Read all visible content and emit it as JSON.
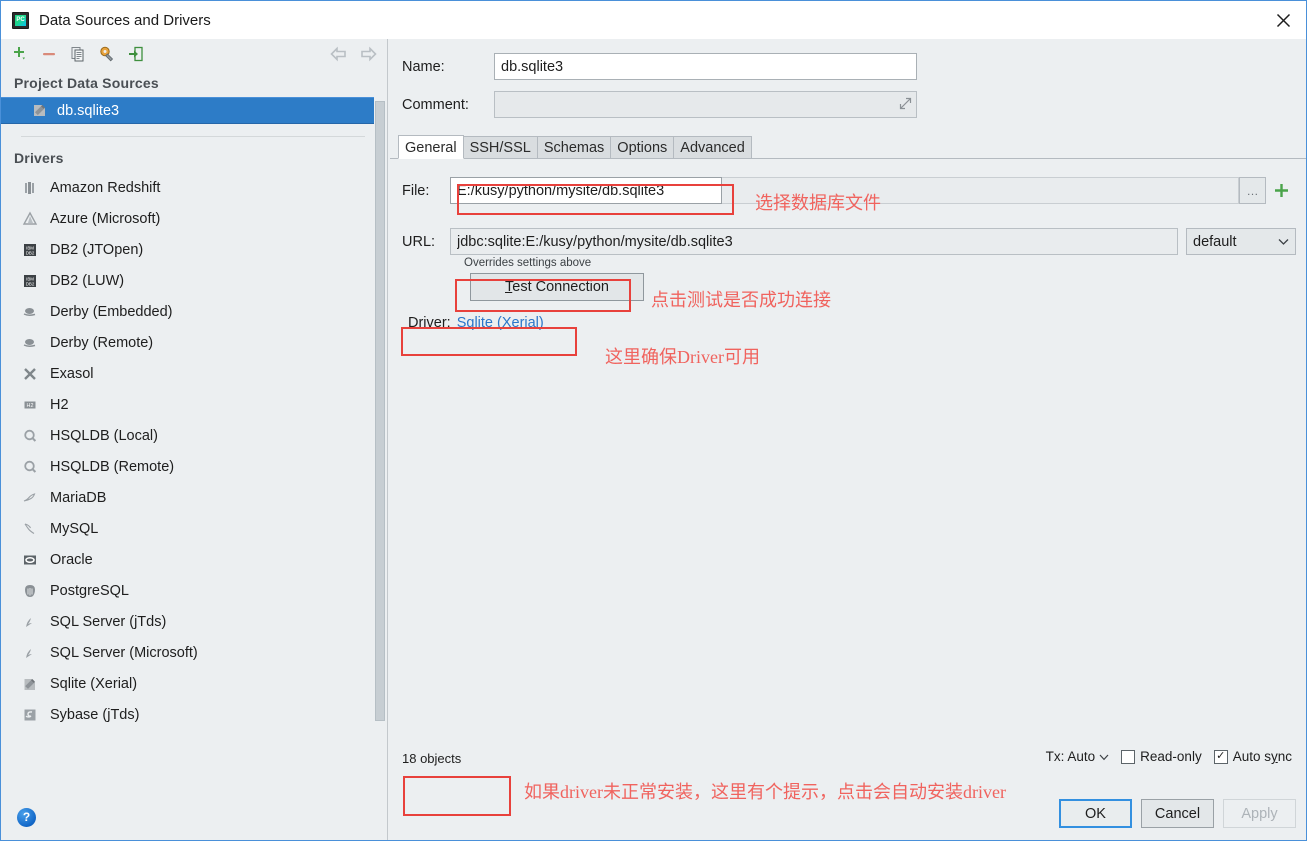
{
  "window": {
    "title": "Data Sources and Drivers",
    "app_icon": "pycharm-icon",
    "close_icon": "close-icon"
  },
  "toolbar": {
    "items": [
      {
        "name": "add-button",
        "icon": "plus-icon",
        "label": "+"
      },
      {
        "name": "remove-button",
        "icon": "minus-icon",
        "label": "—"
      },
      {
        "name": "copy-button",
        "icon": "copy-icon",
        "label": "copy"
      },
      {
        "name": "properties-button",
        "icon": "wrench-icon",
        "label": "properties"
      },
      {
        "name": "import-button",
        "icon": "import-arrow-icon",
        "label": "import"
      }
    ],
    "back_icon": "arrow-left-icon",
    "forward_icon": "arrow-right-icon"
  },
  "sidebar": {
    "project_group_label": "Project Data Sources",
    "data_sources": [
      {
        "label": "db.sqlite3",
        "icon": "sqlite-file-icon",
        "selected": true
      }
    ],
    "drivers_group_label": "Drivers",
    "drivers": [
      {
        "label": "Amazon Redshift",
        "icon": "redshift-icon"
      },
      {
        "label": "Azure (Microsoft)",
        "icon": "azure-icon"
      },
      {
        "label": "DB2 (JTOpen)",
        "icon": "db2-icon"
      },
      {
        "label": "DB2 (LUW)",
        "icon": "db2-icon"
      },
      {
        "label": "Derby (Embedded)",
        "icon": "derby-icon"
      },
      {
        "label": "Derby (Remote)",
        "icon": "derby-icon"
      },
      {
        "label": "Exasol",
        "icon": "exasol-icon"
      },
      {
        "label": "H2",
        "icon": "h2-icon"
      },
      {
        "label": "HSQLDB (Local)",
        "icon": "hsqldb-icon"
      },
      {
        "label": "HSQLDB (Remote)",
        "icon": "hsqldb-icon"
      },
      {
        "label": "MariaDB",
        "icon": "mariadb-icon"
      },
      {
        "label": "MySQL",
        "icon": "mysql-icon"
      },
      {
        "label": "Oracle",
        "icon": "oracle-icon"
      },
      {
        "label": "PostgreSQL",
        "icon": "postgresql-icon"
      },
      {
        "label": "SQL Server (jTds)",
        "icon": "sqlserver-icon"
      },
      {
        "label": "SQL Server (Microsoft)",
        "icon": "sqlserver-icon"
      },
      {
        "label": "Sqlite (Xerial)",
        "icon": "sqlite-icon"
      },
      {
        "label": "Sybase (jTds)",
        "icon": "sybase-icon"
      }
    ],
    "help_icon": "help-icon",
    "help_label": "?"
  },
  "form": {
    "name_label": "Name:",
    "name_value": "db.sqlite3",
    "comment_label": "Comment:",
    "comment_value": "",
    "comment_placeholder": "",
    "expand_icon": "expand-icon"
  },
  "tabs": [
    {
      "label": "General",
      "active": true
    },
    {
      "label": "SSH/SSL",
      "active": false
    },
    {
      "label": "Schemas",
      "active": false
    },
    {
      "label": "Options",
      "active": false
    },
    {
      "label": "Advanced",
      "active": false
    }
  ],
  "general": {
    "file_label": "File:",
    "file_value": "E:/kusy/python/mysite/db.sqlite3",
    "browse_label": "…",
    "browse_icon": "ellipsis-icon",
    "add_icon": "plus-icon",
    "url_label": "URL:",
    "url_value": "jdbc:sqlite:E:/kusy/python/mysite/db.sqlite3",
    "scope_value": "default",
    "scope_chevron_icon": "chevron-down-icon",
    "overrides_note": "Overrides settings above",
    "test_connection_mnemonic": "T",
    "test_connection_rest": "est Connection",
    "driver_label": "Driver:",
    "driver_value": "Sqlite (Xerial)"
  },
  "status": {
    "objects_count": "18 objects",
    "tx_label": "Tx: Auto",
    "tx_chevron_icon": "chevron-down-icon",
    "read_only_label": "Read-only",
    "read_only_checked": false,
    "auto_sync_label_pre": "Auto s",
    "auto_sync_mnemonic": "y",
    "auto_sync_label_post": "nc",
    "auto_sync_checked": true,
    "check_glyph": "✓"
  },
  "buttons": {
    "ok": "OK",
    "cancel": "Cancel",
    "apply": "Apply"
  },
  "annotations": [
    {
      "name": "annotation-select-db-file",
      "text": "选择数据库文件"
    },
    {
      "name": "annotation-test-connection",
      "text": "点击测试是否成功连接"
    },
    {
      "name": "annotation-driver-available",
      "text": "这里确保Driver可用"
    },
    {
      "name": "annotation-driver-install",
      "text": "如果driver未正常安装，这里有个提示，点击会自动安装driver"
    }
  ],
  "colors": {
    "accent": "#2d7cc7",
    "annotation_red": "#e8413c",
    "annotation_text": "#f0635e",
    "link": "#2b76c9",
    "panel_bg": "#eceff1"
  }
}
